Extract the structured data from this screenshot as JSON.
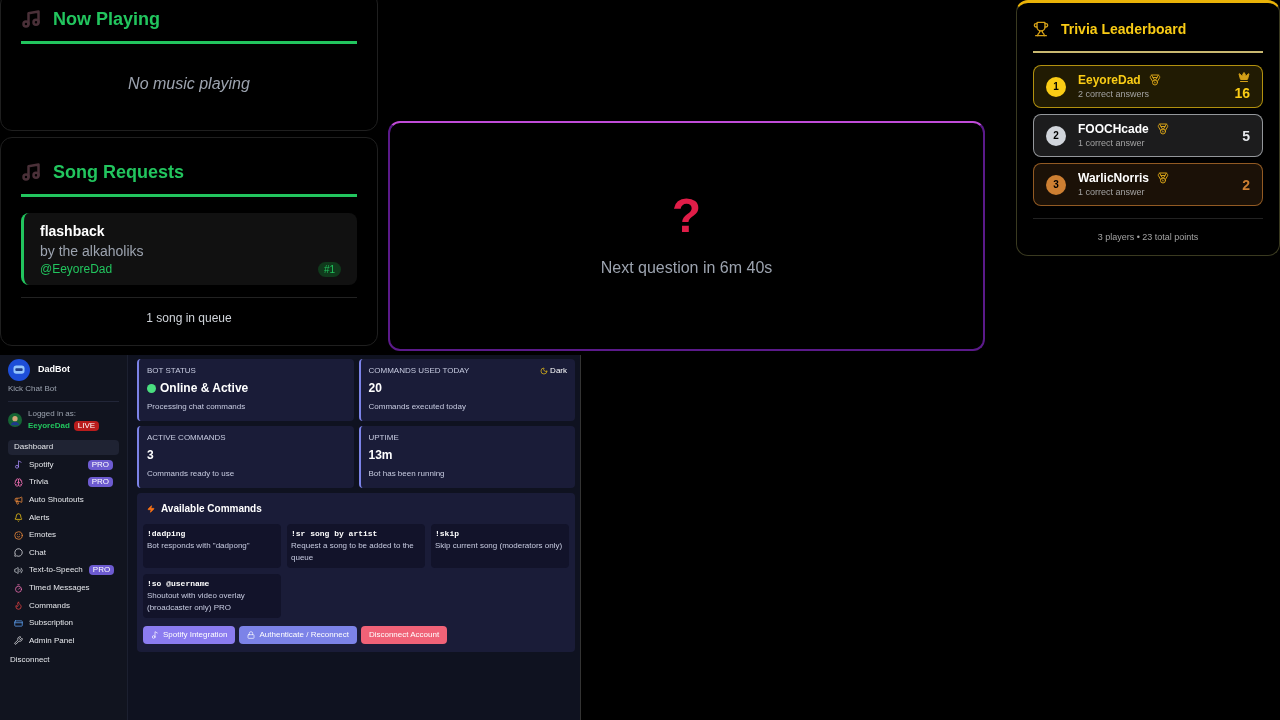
{
  "now_playing": {
    "title": "Now Playing",
    "empty_text": "No music playing"
  },
  "song_requests": {
    "title": "Song Requests",
    "songs": [
      {
        "title": "flashback",
        "artist": "by the alkaholiks",
        "requester": "@EeyoreDad",
        "position": "#1"
      }
    ],
    "footer": "1 song in queue"
  },
  "trivia_question": {
    "symbol": "?",
    "status": "Next question in 6m 40s"
  },
  "leaderboard": {
    "title": "Trivia Leaderboard",
    "players": [
      {
        "rank": "1",
        "name": "EeyoreDad",
        "detail": "2 correct answers",
        "score": "16",
        "crown": true,
        "color": "#facc15"
      },
      {
        "rank": "2",
        "name": "FOOCHcade",
        "detail": "1 correct answer",
        "score": "5",
        "crown": false,
        "color": "#d1d5db"
      },
      {
        "rank": "3",
        "name": "WarlicNorris",
        "detail": "1 correct answer",
        "score": "2",
        "crown": false,
        "color": "#cd7f32"
      }
    ],
    "footer": "3 players • 23 total points"
  },
  "dashboard": {
    "bot_name": "DadBot",
    "bot_subtitle": "Kick Chat Bot",
    "login_label": "Logged in as:",
    "username": "EeyoreDad",
    "live_badge": "LIVE",
    "nav": [
      {
        "label": "Dashboard",
        "selected": true
      },
      {
        "label": "Spotify",
        "badge": "PRO",
        "selected": false
      },
      {
        "label": "Trivia",
        "badge": "PRO",
        "selected": false
      },
      {
        "label": "Auto Shoutouts",
        "selected": false
      },
      {
        "label": "Alerts",
        "selected": false
      },
      {
        "label": "Emotes",
        "selected": false
      },
      {
        "label": "Chat",
        "selected": false
      },
      {
        "label": "Text-to-Speech",
        "badge": "PRO",
        "selected": false
      },
      {
        "label": "Timed Messages",
        "selected": false
      },
      {
        "label": "Commands",
        "selected": false
      },
      {
        "label": "Subscription",
        "selected": false
      },
      {
        "label": "Admin Panel",
        "selected": false
      }
    ],
    "disconnect": "Disconnect",
    "theme_toggle": "Dark",
    "stats": [
      {
        "kind": "status",
        "label": "BOT STATUS",
        "value": "Online & Active",
        "caption": "Processing chat commands"
      },
      {
        "kind": "number",
        "label": "COMMANDS USED TODAY",
        "value": "20",
        "caption": "Commands executed today"
      },
      {
        "kind": "number",
        "label": "ACTIVE COMMANDS",
        "value": "3",
        "caption": "Commands ready to use"
      },
      {
        "kind": "number",
        "label": "UPTIME",
        "value": "13m",
        "caption": "Bot has been running"
      }
    ],
    "commands_title": "Available Commands",
    "commands": [
      {
        "command": "!dadping",
        "description": "Bot responds with \"dadpong\""
      },
      {
        "command": "!sr song by artist",
        "description": "Request a song to be added to the queue"
      },
      {
        "command": "!skip",
        "description": "Skip current song (moderators only)"
      },
      {
        "command": "!so @username",
        "description": "Shoutout with video overlay (broadcaster only) PRO"
      }
    ],
    "buttons": [
      {
        "label": "Spotify Integration",
        "kind": "spotify"
      },
      {
        "label": "Authenticate / Reconnect",
        "kind": "auth"
      },
      {
        "label": "Disconnect Account",
        "kind": "danger"
      }
    ]
  }
}
